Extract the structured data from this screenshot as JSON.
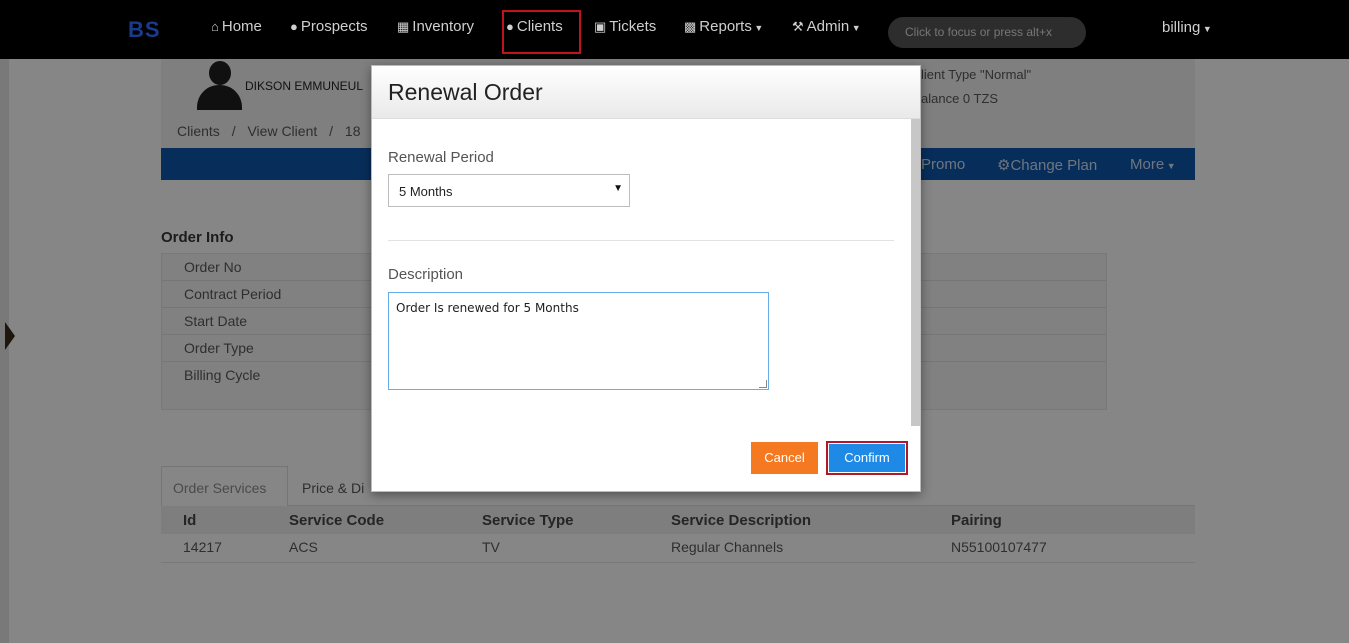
{
  "navbar": {
    "logo": "BS",
    "items": [
      {
        "label": "Home",
        "icon": "home-icon"
      },
      {
        "label": "Prospects",
        "icon": "user-icon"
      },
      {
        "label": "Inventory",
        "icon": "grid-icon"
      },
      {
        "label": "Clients",
        "icon": "users-icon"
      },
      {
        "label": "Tickets",
        "icon": "ticket-icon"
      },
      {
        "label": "Reports",
        "icon": "bar-chart-icon"
      },
      {
        "label": "Admin",
        "icon": "wrench-icon"
      }
    ],
    "search_placeholder": "Click to focus or press alt+x",
    "user": "billing"
  },
  "client": {
    "name": "DIKSON EMMUNEUL",
    "type_line": "lient Type \"Normal\"",
    "balance_line": "alance 0 TZS"
  },
  "breadcrumb": {
    "items": [
      "Clients",
      "View Client",
      "18"
    ],
    "separator": "/"
  },
  "action_bar": {
    "items": [
      "Promo",
      "Change Plan",
      "More"
    ]
  },
  "order_info": {
    "title": "Order Info",
    "rows": [
      "Order No",
      "Contract Period",
      "Start Date",
      "Order Type",
      "Billing Cycle"
    ]
  },
  "tabs": {
    "items": [
      "Order Services",
      "Price & Di"
    ]
  },
  "services": {
    "headers": [
      "Id",
      "Service Code",
      "Service Type",
      "Service Description",
      "Pairing"
    ],
    "rows": [
      [
        "14217",
        "ACS",
        "TV",
        "Regular Channels",
        "N55100107477"
      ]
    ]
  },
  "modal": {
    "title": "Renewal Order",
    "period_label": "Renewal Period",
    "period_value": "5 Months",
    "description_label": "Description",
    "description_value": "Order Is renewed for 5 Months",
    "cancel_label": "Cancel",
    "confirm_label": "Confirm"
  },
  "colors": {
    "navbar": "#000000",
    "action_bar": "#0d55a4",
    "cancel": "#f47920",
    "confirm": "#1f8ae6",
    "highlight": "#c0141b"
  }
}
